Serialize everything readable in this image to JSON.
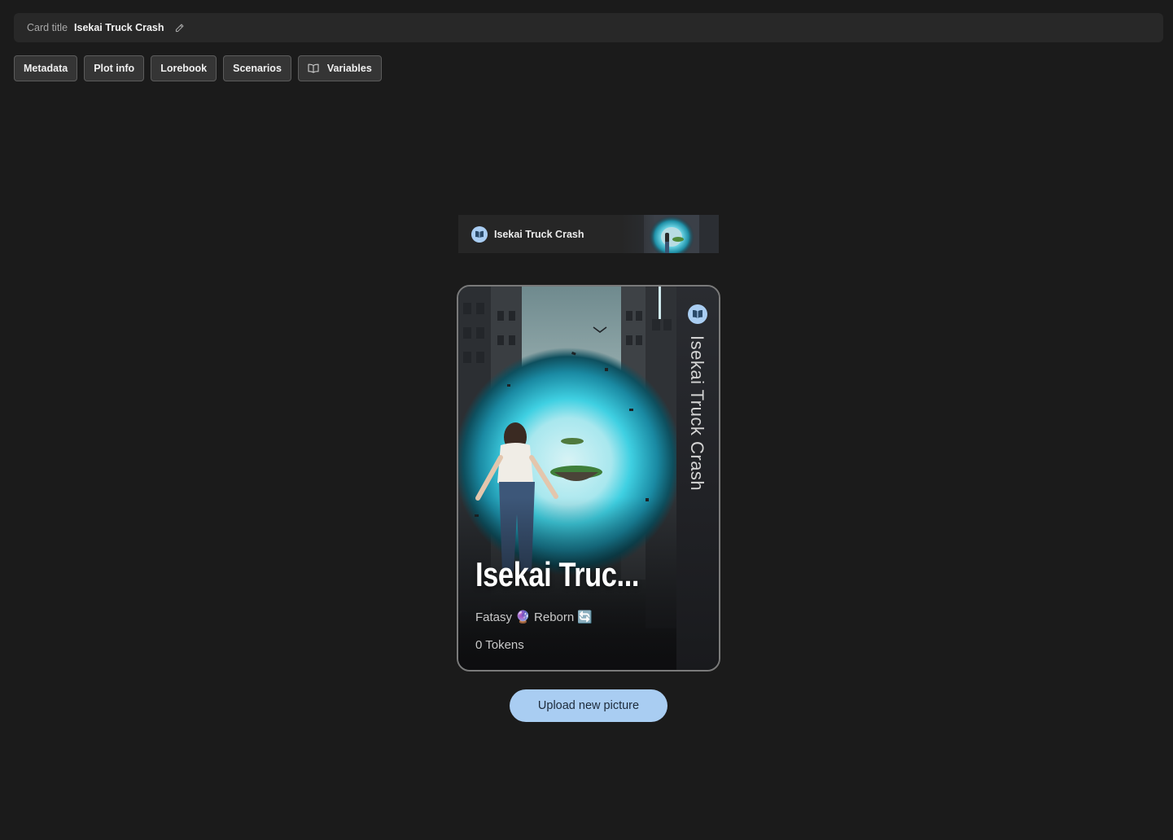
{
  "header": {
    "label": "Card title",
    "value": "Isekai Truck Crash"
  },
  "tabs": [
    {
      "label": "Metadata"
    },
    {
      "label": "Plot info"
    },
    {
      "label": "Lorebook"
    },
    {
      "label": "Scenarios"
    },
    {
      "label": "Variables",
      "icon": "book-icon"
    }
  ],
  "mini_card": {
    "title": "Isekai Truck Crash",
    "badge_icon": "book-icon"
  },
  "card": {
    "side_title": "Isekai Truck Crash",
    "name": "Isekai Truc...",
    "tags": "Fatasy 🔮 Reborn 🔄",
    "tokens": "0 Tokens",
    "badge_icon": "book-icon"
  },
  "upload_button": {
    "label": "Upload new picture"
  },
  "colors": {
    "background": "#1b1b1b",
    "accent": "#a9cdf2",
    "tab_bg": "#353535",
    "portal": "#3fd6e6"
  }
}
